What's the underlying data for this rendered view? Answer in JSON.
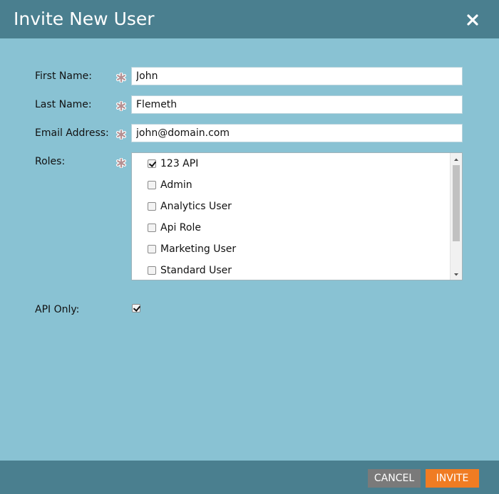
{
  "dialog": {
    "title": "Invite New User",
    "close_icon": "close-icon"
  },
  "form": {
    "first_name": {
      "label": "First Name:",
      "value": "John"
    },
    "last_name": {
      "label": "Last Name:",
      "value": "Flemeth"
    },
    "email": {
      "label": "Email Address:",
      "value": "john@domain.com"
    },
    "roles": {
      "label": "Roles:",
      "items": [
        {
          "label": "123 API",
          "checked": true
        },
        {
          "label": "Admin",
          "checked": false
        },
        {
          "label": "Analytics User",
          "checked": false
        },
        {
          "label": "Api Role",
          "checked": false
        },
        {
          "label": "Marketing User",
          "checked": false
        },
        {
          "label": "Standard User",
          "checked": false
        }
      ]
    },
    "api_only": {
      "label": "API Only:",
      "checked": true
    },
    "required_icon": "asterisk-icon"
  },
  "footer": {
    "cancel_label": "CANCEL",
    "invite_label": "INVITE"
  },
  "colors": {
    "header_bg": "#4a7f8f",
    "body_bg": "#89c2d3",
    "cancel_bg": "#7a7a7a",
    "invite_bg": "#f07c23",
    "required_asterisk": "#c9302c"
  }
}
